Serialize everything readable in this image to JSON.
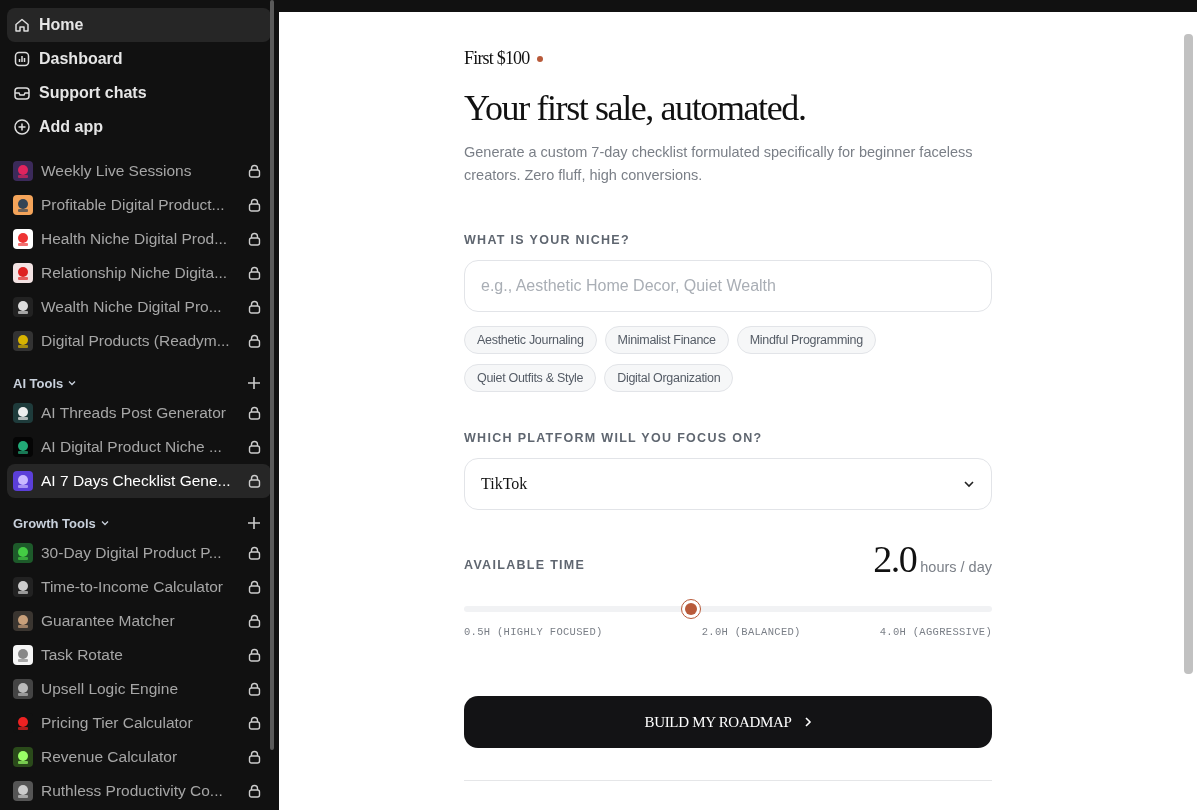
{
  "sidebar": {
    "nav": [
      {
        "label": "Home",
        "selected": true
      },
      {
        "label": "Dashboard",
        "selected": false
      },
      {
        "label": "Support chats",
        "selected": false
      },
      {
        "label": "Add app",
        "selected": false
      }
    ],
    "apps": [
      {
        "label": "Weekly Live Sessions",
        "locked": true,
        "selected": false
      },
      {
        "label": "Profitable Digital Product...",
        "locked": true,
        "selected": false
      },
      {
        "label": "Health Niche Digital Prod...",
        "locked": true,
        "selected": false
      },
      {
        "label": "Relationship Niche Digita...",
        "locked": true,
        "selected": false
      },
      {
        "label": "Wealth Niche Digital Pro...",
        "locked": true,
        "selected": false
      },
      {
        "label": "Digital Products (Readym...",
        "locked": true,
        "selected": false
      }
    ],
    "sections": [
      {
        "title": "AI Tools",
        "expanded": true,
        "items": [
          {
            "label": "AI Threads Post Generator",
            "locked": true,
            "selected": false
          },
          {
            "label": "AI Digital Product Niche ...",
            "locked": true,
            "selected": false
          },
          {
            "label": "AI 7 Days Checklist Gene...",
            "locked": true,
            "selected": true
          }
        ]
      },
      {
        "title": "Growth Tools",
        "expanded": true,
        "items": [
          {
            "label": "30-Day Digital Product P...",
            "locked": true,
            "selected": false
          },
          {
            "label": "Time-to-Income Calculator",
            "locked": true,
            "selected": false
          },
          {
            "label": "Guarantee Matcher",
            "locked": true,
            "selected": false
          },
          {
            "label": "Task Rotate",
            "locked": true,
            "selected": false
          },
          {
            "label": "Upsell Logic Engine",
            "locked": true,
            "selected": false
          },
          {
            "label": "Pricing Tier Calculator",
            "locked": true,
            "selected": false
          },
          {
            "label": "Revenue Calculator",
            "locked": true,
            "selected": false
          },
          {
            "label": "Ruthless Productivity Co...",
            "locked": true,
            "selected": false
          }
        ]
      }
    ]
  },
  "main": {
    "eyebrow": "First $100",
    "title": "Your first sale, automated.",
    "intro": "Generate a custom 7-day checklist formulated specifically for beginner faceless creators. Zero fluff, high conversions.",
    "niche": {
      "label": "WHAT IS YOUR NICHE?",
      "placeholder": "e.g., Aesthetic Home Decor, Quiet Wealth",
      "chips": [
        "Aesthetic Journaling",
        "Minimalist Finance",
        "Mindful Programming",
        "Quiet Outfits & Style",
        "Digital Organization"
      ]
    },
    "platform": {
      "label": "WHICH PLATFORM WILL YOU FOCUS ON?",
      "value": "TikTok"
    },
    "time": {
      "label": "AVAILABLE TIME",
      "value": "2.0",
      "unit": "hours / day",
      "level": 0.43,
      "ticks": [
        "0.5H (HIGHLY FOCUSED)",
        "2.0H (BALANCED)",
        "4.0H (AGGRESSIVE)"
      ]
    },
    "button": "BUILD MY ROADMAP"
  }
}
